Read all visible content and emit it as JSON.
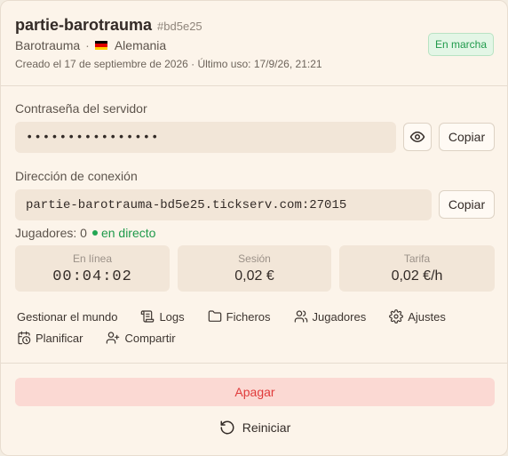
{
  "header": {
    "server_name": "partie-barotrauma",
    "server_id": "#bd5e25",
    "game": "Barotrauma",
    "separator": "·",
    "country": "Alemania",
    "flag_colors": [
      "#000000",
      "#dd0000",
      "#ffce00"
    ],
    "meta": "Creado el 17 de septiembre de 2026 · Último uso: 17/9/26, 21:21",
    "status_badge": "En marcha"
  },
  "password": {
    "label": "Contraseña del servidor",
    "masked_value": "••••••••••••••••",
    "reveal_icon": "eye-icon",
    "copy_label": "Copiar"
  },
  "connection": {
    "label": "Dirección de conexión",
    "address": "partie-barotrauma-bd5e25.tickserv.com:27015",
    "copy_label": "Copiar"
  },
  "players": {
    "label": "Jugadores: 0",
    "live_label": "en directo"
  },
  "stats": [
    {
      "label": "En línea",
      "value": "00:04:02"
    },
    {
      "label": "Sesión",
      "value": "0,02 €"
    },
    {
      "label": "Tarifa",
      "value": "0,02 €/h"
    }
  ],
  "actions_row1": [
    {
      "label": "Gestionar el mundo",
      "icon": ""
    },
    {
      "label": "Logs",
      "icon": "scroll-icon"
    },
    {
      "label": "Ficheros",
      "icon": "folder-icon"
    },
    {
      "label": "Jugadores",
      "icon": "users-icon"
    },
    {
      "label": "Ajustes",
      "icon": "gear-icon"
    }
  ],
  "actions_row2": [
    {
      "label": "Planificar",
      "icon": "calendar-clock-icon"
    },
    {
      "label": "Compartir",
      "icon": "user-plus-icon"
    }
  ],
  "footer": {
    "stop_label": "Apagar",
    "restart_label": "Reiniciar",
    "restart_icon": "rotate-ccw-icon"
  }
}
